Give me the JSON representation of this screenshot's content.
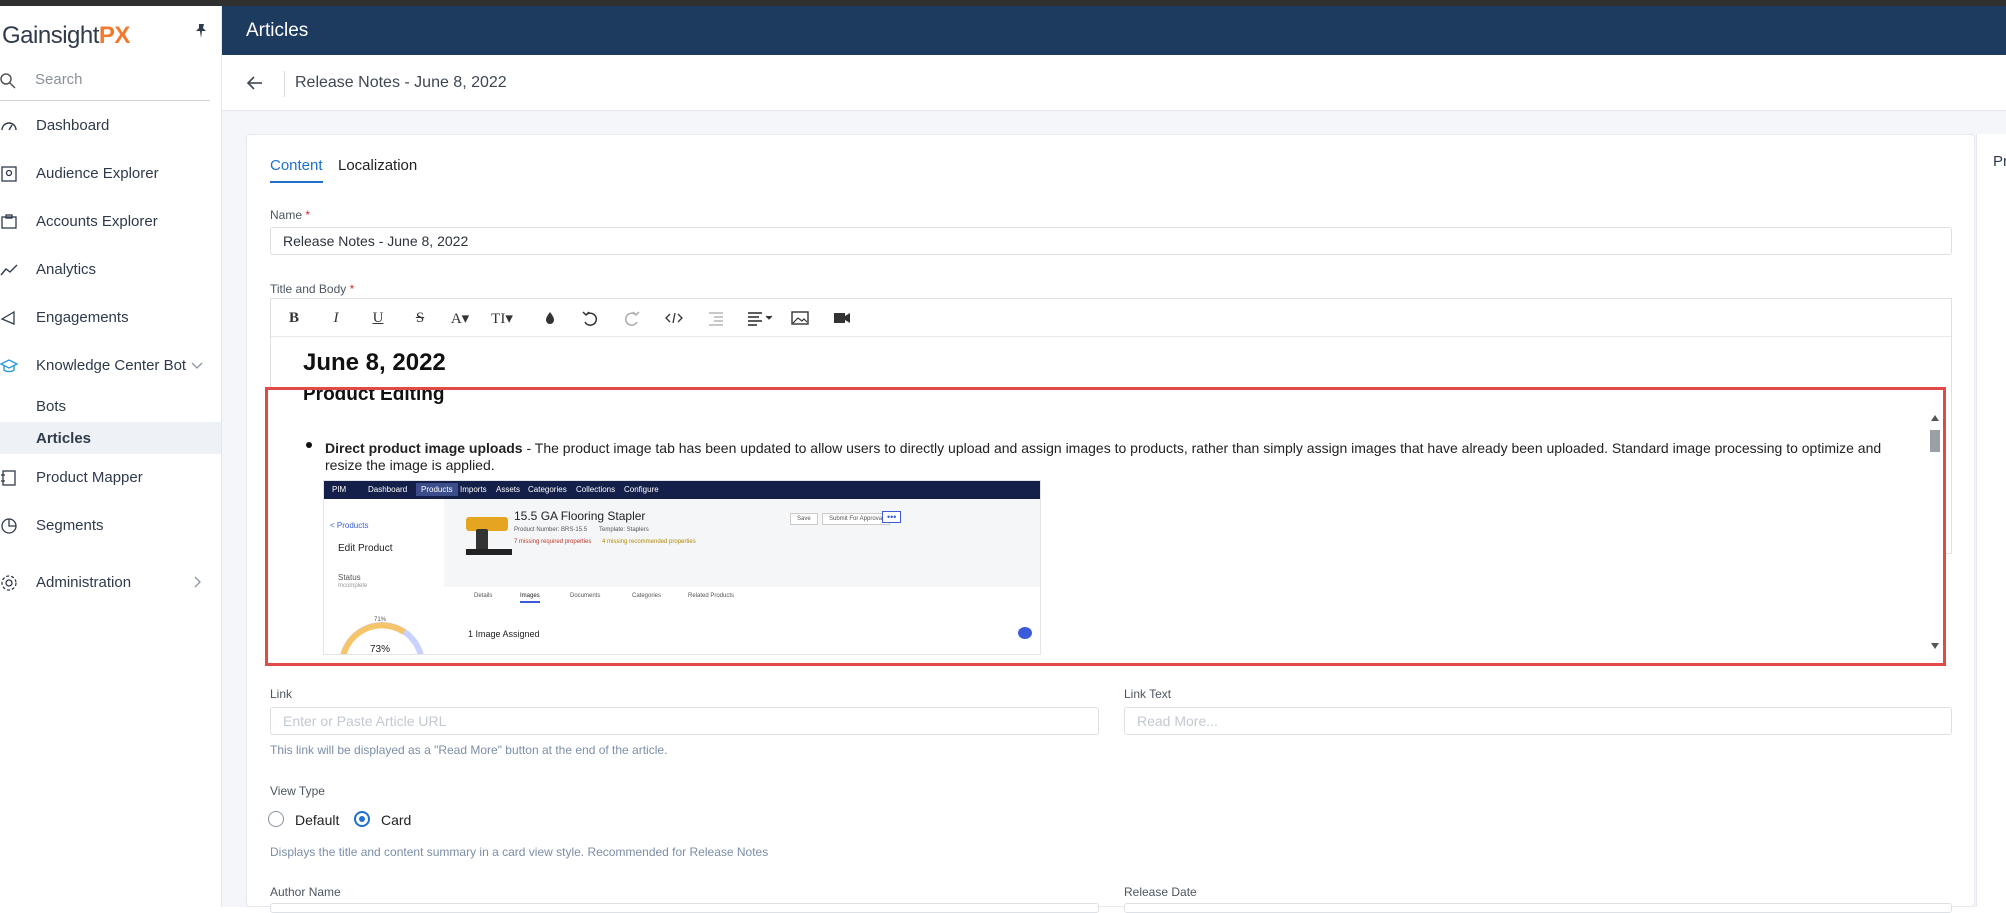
{
  "app": {
    "logo_main": "Gainsight",
    "logo_accent": "PX"
  },
  "sidebar": {
    "search_placeholder": "Search",
    "items": [
      {
        "label": "Dashboard"
      },
      {
        "label": "Audience Explorer"
      },
      {
        "label": "Accounts Explorer"
      },
      {
        "label": "Analytics"
      },
      {
        "label": "Engagements"
      },
      {
        "label": "Knowledge Center Bot"
      },
      {
        "label": "Bots"
      },
      {
        "label": "Articles"
      },
      {
        "label": "Product Mapper"
      },
      {
        "label": "Segments"
      },
      {
        "label": "Administration"
      }
    ]
  },
  "header": {
    "title": "Articles"
  },
  "breadcrumb": {
    "title": "Release Notes - June 8, 2022"
  },
  "right_panel": {
    "partial_label": "Pr"
  },
  "tabs": [
    {
      "label": "Content"
    },
    {
      "label": "Localization"
    }
  ],
  "form": {
    "name_label": "Name",
    "name_required": "*",
    "name_value": "Release Notes - June 8, 2022",
    "body_label": "Title and Body",
    "body_required": "*",
    "editor_heading": "June 8, 2022",
    "section_heading": "Product Editing",
    "bullet_title": "Direct product image uploads",
    "bullet_text": " - The product image tab has been updated to allow users to directly upload and assign images to products, rather than simply assign images that have already been uploaded. Standard image processing to optimize and resize the image is applied.",
    "link_label": "Link",
    "link_placeholder": "Enter or Paste Article URL",
    "link_hint": "This link will be displayed as a \"Read More\" button at the end of the article.",
    "link_text_label": "Link Text",
    "link_text_placeholder": "Read More...",
    "view_type_label": "View Type",
    "view_default": "Default",
    "view_card": "Card",
    "view_type_selected": "Card",
    "view_hint": "Displays the title and content summary in a card view style. Recommended for Release Notes",
    "author_label": "Author Name",
    "release_date_label": "Release Date"
  },
  "embedded_screenshot": {
    "nav": [
      "PIM",
      "Dashboard",
      "Products",
      "Imports",
      "Assets",
      "Categories",
      "Collections",
      "Configure"
    ],
    "back_link": "< Products",
    "page_title": "Edit Product",
    "status_label": "Status",
    "status_value": "Incomplete",
    "product_name": "15.5 GA Flooring Stapler",
    "product_number": "Product Number: BRS-15.5",
    "template": "Template: Staplers",
    "missing_required": "7 missing required properties",
    "missing_recommended": "4 missing recommended properties",
    "save": "Save",
    "submit": "Submit For Approval",
    "tabs": [
      "Details",
      "Images",
      "Documents",
      "Categories",
      "Related Products"
    ],
    "images_assigned": "1 Image Assigned",
    "gauge_top": "71%",
    "gauge_value": "73%"
  },
  "colors": {
    "header_bg": "#1d3a5f",
    "accent": "#1f6fd1",
    "highlight_border": "#e24a4a",
    "logo_accent": "#f27a30"
  }
}
